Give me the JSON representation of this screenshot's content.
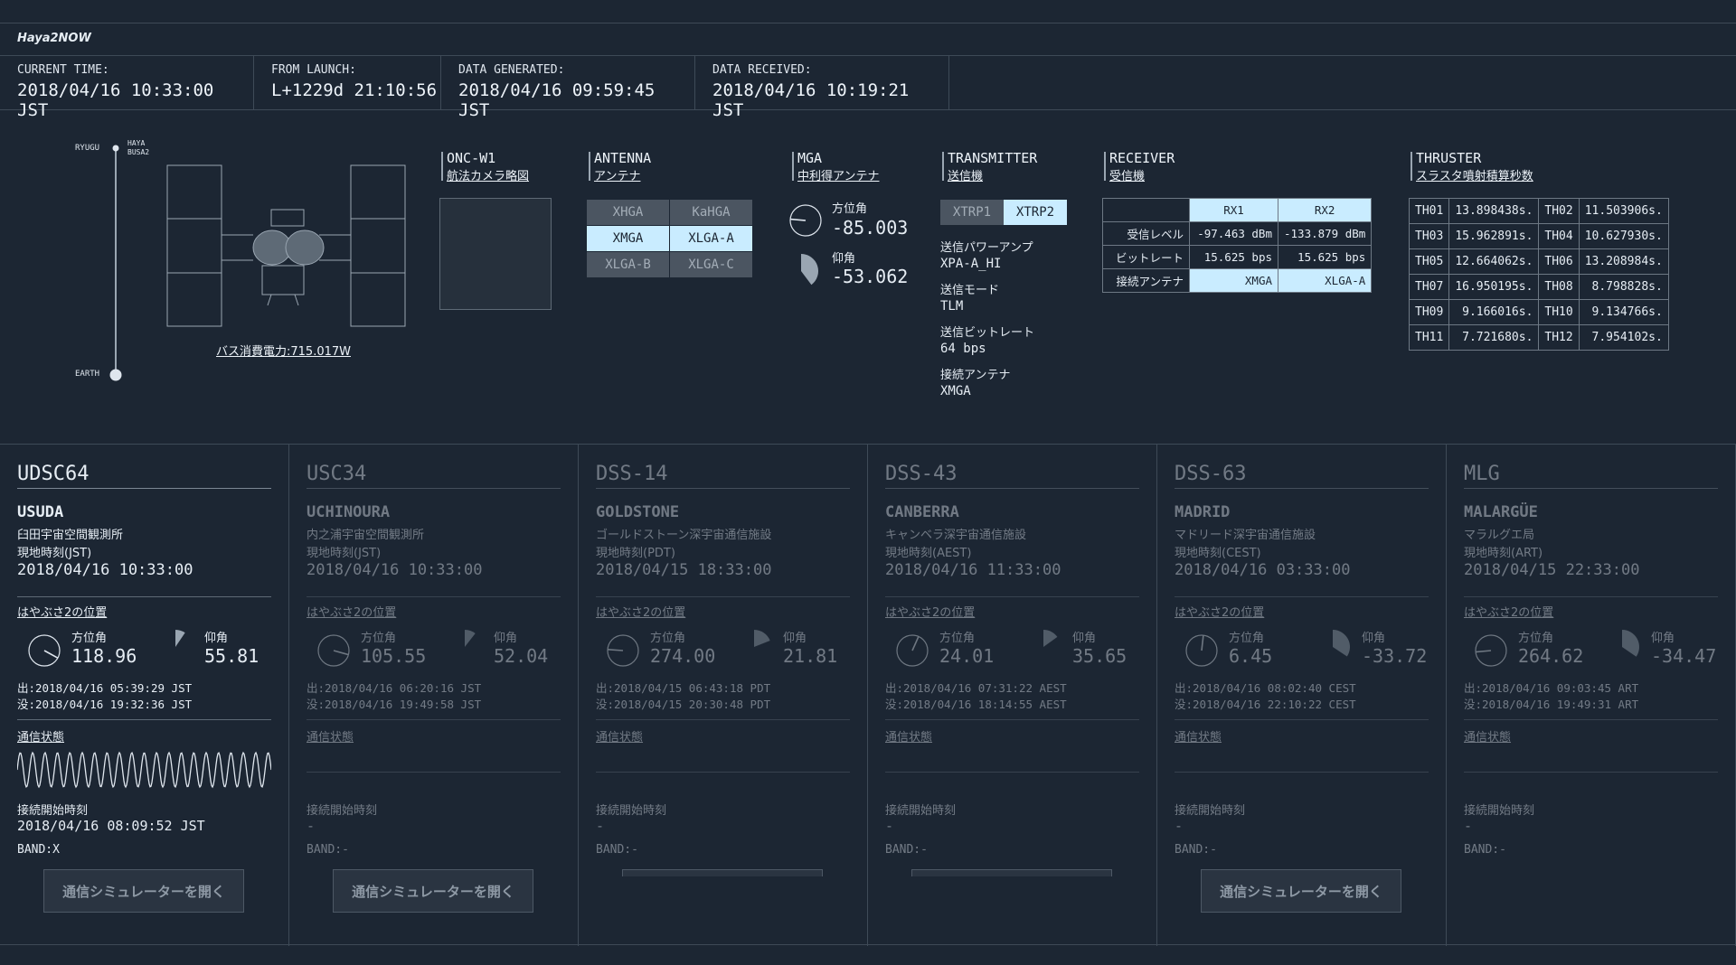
{
  "app": {
    "title": "Haya2NOW"
  },
  "times": [
    {
      "label": "CURRENT TIME:",
      "value": "2018/04/16 10:33:00 JST"
    },
    {
      "label": "FROM LAUNCH:",
      "value": "L+1229d 21:10:56"
    },
    {
      "label": "DATA GENERATED:",
      "value": "2018/04/16 09:59:45 JST"
    },
    {
      "label": "DATA RECEIVED:",
      "value": "2018/04/16 10:19:21 JST"
    }
  ],
  "craft": {
    "ryugu": "RYUGU",
    "haya1": "HAYA",
    "haya2": "BUSA2",
    "earth": "EARTH",
    "power": "バス消費電力:715.017W"
  },
  "onc": {
    "title": "ONC-W1",
    "subtitle": "航法カメラ略図"
  },
  "antenna": {
    "title": "ANTENNA",
    "subtitle": "アンテナ",
    "cells": [
      {
        "label": "XHGA",
        "active": false
      },
      {
        "label": "KaHGA",
        "active": false
      },
      {
        "label": "XMGA",
        "active": true
      },
      {
        "label": "XLGA-A",
        "active": true
      },
      {
        "label": "XLGA-B",
        "active": false
      },
      {
        "label": "XLGA-C",
        "active": false
      }
    ]
  },
  "mga": {
    "title": "MGA",
    "subtitle": "中利得アンテナ",
    "az_label": "方位角",
    "az_value": "-85.003",
    "el_label": "仰角",
    "el_value": "-53.062",
    "az_deg": -85.003,
    "el_deg": -53.062
  },
  "transmitter": {
    "title": "TRANSMITTER",
    "subtitle": "送信機",
    "xtrp1": "XTRP1",
    "xtrp2": "XTRP2",
    "items": [
      {
        "label": "送信パワーアンプ",
        "value": "XPA-A_HI"
      },
      {
        "label": "送信モード",
        "value": "TLM"
      },
      {
        "label": "送信ビットレート",
        "value": "64 bps"
      },
      {
        "label": "接続アンテナ",
        "value": "XMGA"
      }
    ]
  },
  "receiver": {
    "title": "RECEIVER",
    "subtitle": "受信機",
    "cols": [
      "RX1",
      "RX2"
    ],
    "rows": [
      {
        "label": "受信レベル",
        "rx1": "-97.463 dBm",
        "rx2": "-133.879 dBm"
      },
      {
        "label": "ビットレート",
        "rx1": "15.625 bps",
        "rx2": "15.625 bps"
      },
      {
        "label": "接続アンテナ",
        "rx1": "XMGA",
        "rx2": "XLGA-A"
      }
    ]
  },
  "thruster": {
    "title": "THRUSTER",
    "subtitle": "スラスタ噴射積算秒数",
    "rows": [
      {
        "a": "TH01",
        "av": "13.898438s.",
        "b": "TH02",
        "bv": "11.503906s."
      },
      {
        "a": "TH03",
        "av": "15.962891s.",
        "b": "TH04",
        "bv": "10.627930s."
      },
      {
        "a": "TH05",
        "av": "12.664062s.",
        "b": "TH06",
        "bv": "13.208984s."
      },
      {
        "a": "TH07",
        "av": "16.950195s.",
        "b": "TH08",
        "bv": "8.798828s."
      },
      {
        "a": "TH09",
        "av": "9.166016s.",
        "b": "TH10",
        "bv": "9.134766s."
      },
      {
        "a": "TH11",
        "av": "7.721680s.",
        "b": "TH12",
        "bv": "7.954102s."
      }
    ]
  },
  "stations": [
    {
      "code": "UDSC64",
      "name": "USUDA",
      "jp": "臼田宇宙空間観測所",
      "tz_label": "現地時刻(JST)",
      "local_time": "2018/04/16 10:33:00",
      "pos_label": "はやぶさ2の位置",
      "az_label": "方位角",
      "az": "118.96",
      "el_label": "仰角",
      "el": "55.81",
      "az_deg": 118.96,
      "el_deg": 55.81,
      "rise": "出:2018/04/16 05:39:29 JST",
      "set": "没:2018/04/16 19:32:36 JST",
      "comms_label": "通信状態",
      "conn_label": "接続開始時刻",
      "conn_time": "2018/04/16 08:09:52 JST",
      "band": "BAND:X",
      "button": "通信シミュレーターを開く",
      "active": true,
      "btn": "full"
    },
    {
      "code": "USC34",
      "name": "UCHINOURA",
      "jp": "内之浦宇宙空間観測所",
      "tz_label": "現地時刻(JST)",
      "local_time": "2018/04/16 10:33:00",
      "pos_label": "はやぶさ2の位置",
      "az_label": "方位角",
      "az": "105.55",
      "el_label": "仰角",
      "el": "52.04",
      "az_deg": 105.55,
      "el_deg": 52.04,
      "rise": "出:2018/04/16 06:20:16 JST",
      "set": "没:2018/04/16 19:49:58 JST",
      "comms_label": "通信状態",
      "conn_label": "接続開始時刻",
      "conn_time": "-",
      "band": "BAND:-",
      "button": "通信シミュレーターを開く",
      "active": false,
      "btn": "full"
    },
    {
      "code": "DSS-14",
      "name": "GOLDSTONE",
      "jp": "ゴールドストーン深宇宙通信施設",
      "tz_label": "現地時刻(PDT)",
      "local_time": "2018/04/15 18:33:00",
      "pos_label": "はやぶさ2の位置",
      "az_label": "方位角",
      "az": "274.00",
      "el_label": "仰角",
      "el": "21.81",
      "az_deg": 274.0,
      "el_deg": 21.81,
      "rise": "出:2018/04/15 06:43:18 PDT",
      "set": "没:2018/04/15 20:30:48 PDT",
      "comms_label": "通信状態",
      "conn_label": "接続開始時刻",
      "conn_time": "-",
      "band": "BAND:-",
      "button": "",
      "active": false,
      "btn": "stub"
    },
    {
      "code": "DSS-43",
      "name": "CANBERRA",
      "jp": "キャンベラ深宇宙通信施設",
      "tz_label": "現地時刻(AEST)",
      "local_time": "2018/04/16 11:33:00",
      "pos_label": "はやぶさ2の位置",
      "az_label": "方位角",
      "az": "24.01",
      "el_label": "仰角",
      "el": "35.65",
      "az_deg": 24.01,
      "el_deg": 35.65,
      "rise": "出:2018/04/16 07:31:22 AEST",
      "set": "没:2018/04/16 18:14:55 AEST",
      "comms_label": "通信状態",
      "conn_label": "接続開始時刻",
      "conn_time": "-",
      "band": "BAND:-",
      "button": "",
      "active": false,
      "btn": "stub"
    },
    {
      "code": "DSS-63",
      "name": "MADRID",
      "jp": "マドリード深宇宙通信施設",
      "tz_label": "現地時刻(CEST)",
      "local_time": "2018/04/16 03:33:00",
      "pos_label": "はやぶさ2の位置",
      "az_label": "方位角",
      "az": "6.45",
      "el_label": "仰角",
      "el": "-33.72",
      "az_deg": 6.45,
      "el_deg": -33.72,
      "rise": "出:2018/04/16 08:02:40 CEST",
      "set": "没:2018/04/16 22:10:22 CEST",
      "comms_label": "通信状態",
      "conn_label": "接続開始時刻",
      "conn_time": "-",
      "band": "BAND:-",
      "button": "通信シミュレーターを開く",
      "active": false,
      "btn": "full"
    },
    {
      "code": "MLG",
      "name": "MALARGÜE",
      "jp": "マラルグエ局",
      "tz_label": "現地時刻(ART)",
      "local_time": "2018/04/15 22:33:00",
      "pos_label": "はやぶさ2の位置",
      "az_label": "方位角",
      "az": "264.62",
      "el_label": "仰角",
      "el": "-34.47",
      "az_deg": 264.62,
      "el_deg": -34.47,
      "rise": "出:2018/04/16 09:03:45 ART",
      "set": "没:2018/04/16 19:49:31 ART",
      "comms_label": "通信状態",
      "conn_label": "接続開始時刻",
      "conn_time": "-",
      "band": "BAND:-",
      "button": "",
      "active": false,
      "btn": "none"
    }
  ]
}
